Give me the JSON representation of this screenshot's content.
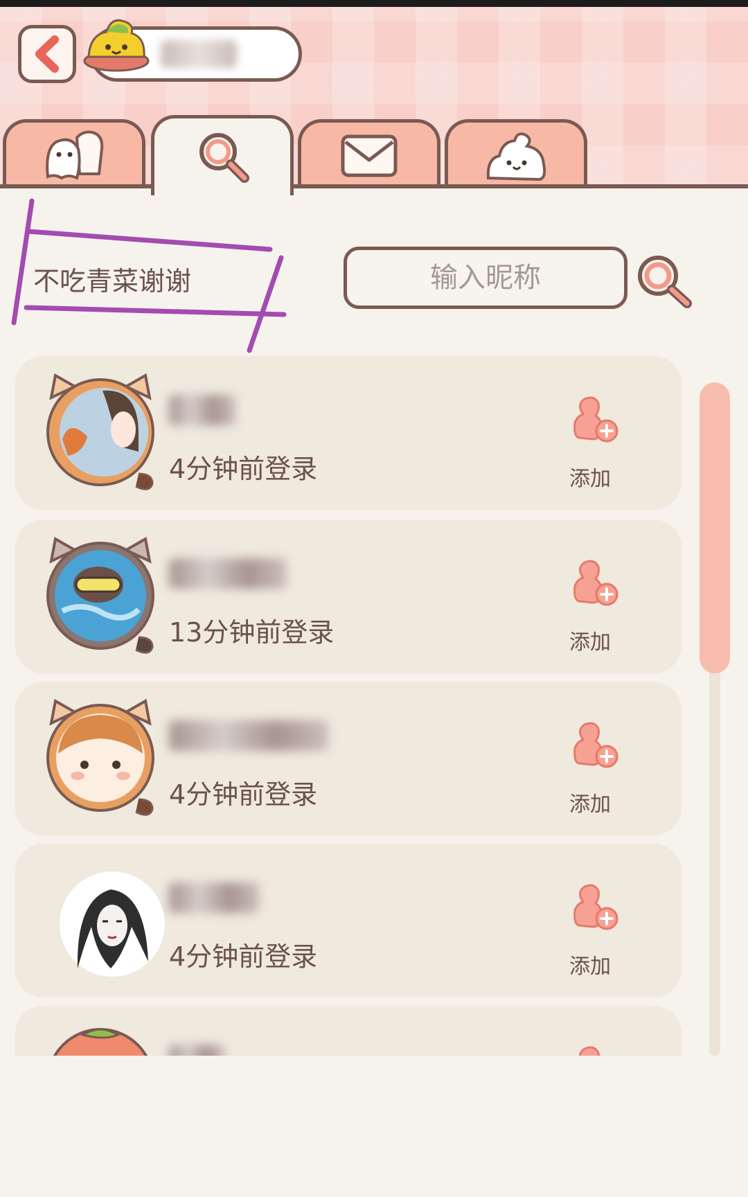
{
  "header": {
    "back_icon": "chevron-left-icon",
    "profile_avatar_icon": "blob-face-icon"
  },
  "tabs": [
    {
      "name": "friends",
      "icon": "ghost-friends-icon",
      "active": false
    },
    {
      "name": "search",
      "icon": "magnifier-icon",
      "active": true
    },
    {
      "name": "mail",
      "icon": "envelope-icon",
      "active": false
    },
    {
      "name": "pet",
      "icon": "blob-face-icon",
      "active": false
    }
  ],
  "search": {
    "nickname": "不吃青菜谢谢",
    "placeholder": "输入昵称",
    "button_icon": "magnifier-icon"
  },
  "results": [
    {
      "status": "4分钟前登录",
      "add_label": "添加",
      "add_icon": "add-friend-icon"
    },
    {
      "status": "13分钟前登录",
      "add_label": "添加",
      "add_icon": "add-friend-icon"
    },
    {
      "status": "4分钟前登录",
      "add_label": "添加",
      "add_icon": "add-friend-icon"
    },
    {
      "status": "4分钟前登录",
      "add_label": "添加",
      "add_icon": "add-friend-icon"
    },
    {
      "status": "",
      "add_label": "",
      "add_icon": "add-friend-icon"
    }
  ],
  "colors": {
    "outline": "#7a5a52",
    "tab_fill": "#f8b8a6",
    "accent": "#f39a8a",
    "row_bg": "#efe9de",
    "annotation": "#a44bb0"
  }
}
